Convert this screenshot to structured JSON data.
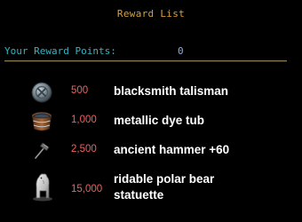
{
  "window": {
    "title": "Reward List"
  },
  "points": {
    "label": "Your Reward Points:",
    "value": "0"
  },
  "rewards": [
    {
      "cost": "500",
      "name": "blacksmith talisman",
      "icon": "talisman-icon"
    },
    {
      "cost": "1,000",
      "name": "metallic dye tub",
      "icon": "dye-tub-icon"
    },
    {
      "cost": "2,500",
      "name": "ancient hammer +60",
      "icon": "hammer-icon"
    },
    {
      "cost": "15,000",
      "name_line1": "ridable polar bear",
      "name_line2": "statuette",
      "icon": "polar-bear-statuette-icon"
    }
  ],
  "colors": {
    "title": "#d8a23a",
    "points_label": "#2fb5c4",
    "points_value": "#8fa8e6",
    "cost": "#f06060",
    "item_name": "#ffffff",
    "background": "#000000"
  }
}
